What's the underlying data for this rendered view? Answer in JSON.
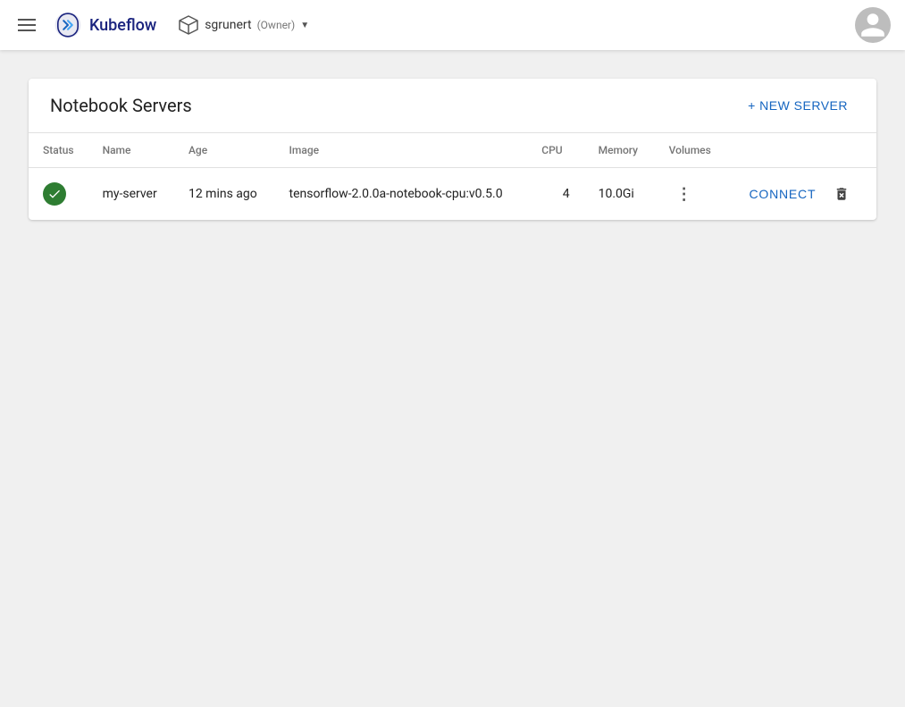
{
  "header": {
    "brand_name": "Kubeflow",
    "namespace": "sgrunert",
    "namespace_role": "(Owner)",
    "hamburger_label": "Menu"
  },
  "page": {
    "title": "Notebook Servers",
    "new_server_label": "+ NEW SERVER"
  },
  "table": {
    "columns": [
      "Status",
      "Name",
      "Age",
      "Image",
      "CPU",
      "Memory",
      "Volumes"
    ],
    "rows": [
      {
        "status": "running",
        "name": "my-server",
        "age": "12 mins ago",
        "image": "tensorflow-2.0.0a-notebook-cpu:v0.5.0",
        "cpu": "4",
        "memory": "10.0Gi",
        "volumes": "⋮",
        "connect_label": "CONNECT"
      }
    ]
  },
  "colors": {
    "accent": "#1565c0",
    "status_running": "#2e7d32",
    "header_bg": "#ffffff",
    "card_bg": "#ffffff",
    "body_bg": "#f0f0f0"
  }
}
